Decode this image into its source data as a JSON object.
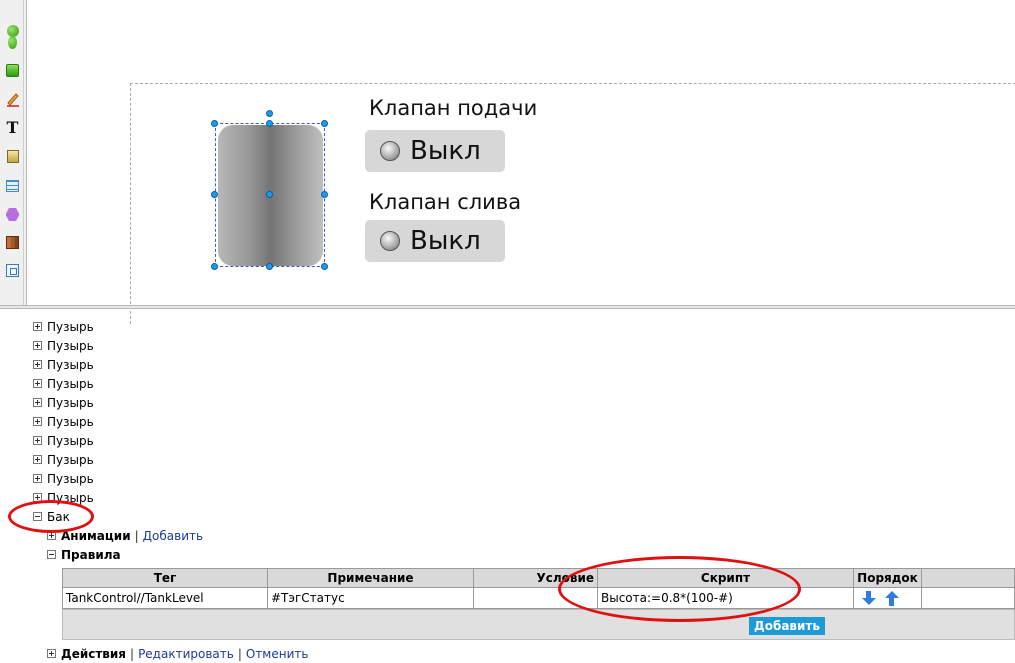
{
  "toolbar": {
    "icons": [
      "circle-icon",
      "ellipse-icon",
      "rectangle-icon",
      "pen-icon",
      "text-icon",
      "image-icon",
      "table-icon",
      "polygon-icon",
      "group-icon",
      "frame-icon"
    ]
  },
  "canvas": {
    "valve_feed": {
      "label": "Клапан подачи",
      "state": "Выкл"
    },
    "valve_drain": {
      "label": "Клапан слива",
      "state": "Выкл"
    }
  },
  "tree": {
    "bubble_items": [
      "Пузырь",
      "Пузырь",
      "Пузырь",
      "Пузырь",
      "Пузырь",
      "Пузырь",
      "Пузырь",
      "Пузырь",
      "Пузырь",
      "Пузырь"
    ],
    "tank_node": "Бак",
    "animations_label": "Анимации",
    "animations_add": "Добавить",
    "rules_label": "Правила",
    "actions_label": "Действия",
    "actions_edit": "Редактировать",
    "actions_cancel": "Отменить",
    "separator": "|"
  },
  "rules_table": {
    "headers": [
      "Тег",
      "Примечание",
      "Условие",
      "Скрипт",
      "Порядок"
    ],
    "rows": [
      {
        "tag": "TankControl//TankLevel",
        "note": "#ТэгСтатус",
        "condition": "",
        "script": "Высота:=0.8*(100-#)"
      }
    ],
    "add_button": "Добавить"
  },
  "colors": {
    "accent": "#1d9bd6",
    "annotation": "#e01010",
    "selection": "#1e9be8"
  }
}
